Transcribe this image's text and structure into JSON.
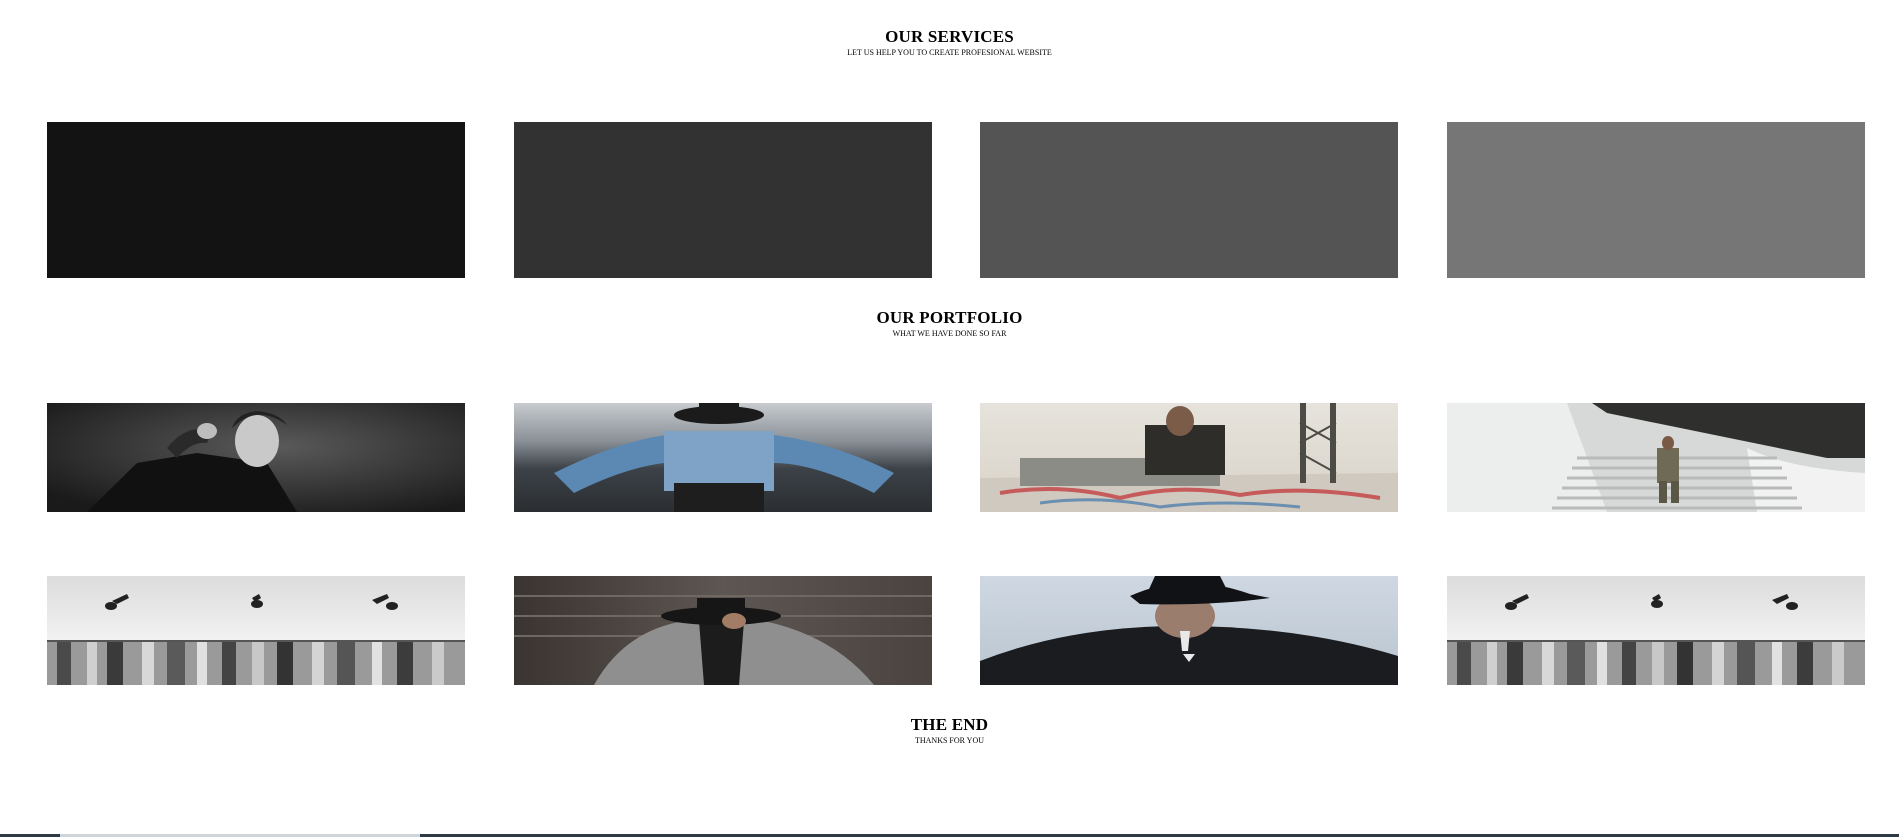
{
  "services": {
    "title": "OUR SERVICES",
    "subtitle": "LET US HELP YOU TO CREATE PROFESIONAL WEBSITE",
    "cards": [
      {
        "color": "#131313"
      },
      {
        "color": "#323232"
      },
      {
        "color": "#545454"
      },
      {
        "color": "#767676"
      }
    ]
  },
  "portfolio": {
    "title": "OUR PORTFOLIO",
    "subtitle": "WHAT WE HAVE DONE SO FAR",
    "items": [
      {
        "subject": "man-in-black-jacket-bw"
      },
      {
        "subject": "person-in-denim-jacket-hat"
      },
      {
        "subject": "man-sitting-on-car-roof"
      },
      {
        "subject": "man-walking-down-stairs"
      },
      {
        "subject": "clothing-rack-store"
      },
      {
        "subject": "person-in-hat-grey-coat"
      },
      {
        "subject": "man-in-black-cap"
      },
      {
        "subject": "clothing-rack-store"
      }
    ]
  },
  "end": {
    "title": "THE END",
    "subtitle": "THANKS FOR YOU"
  }
}
